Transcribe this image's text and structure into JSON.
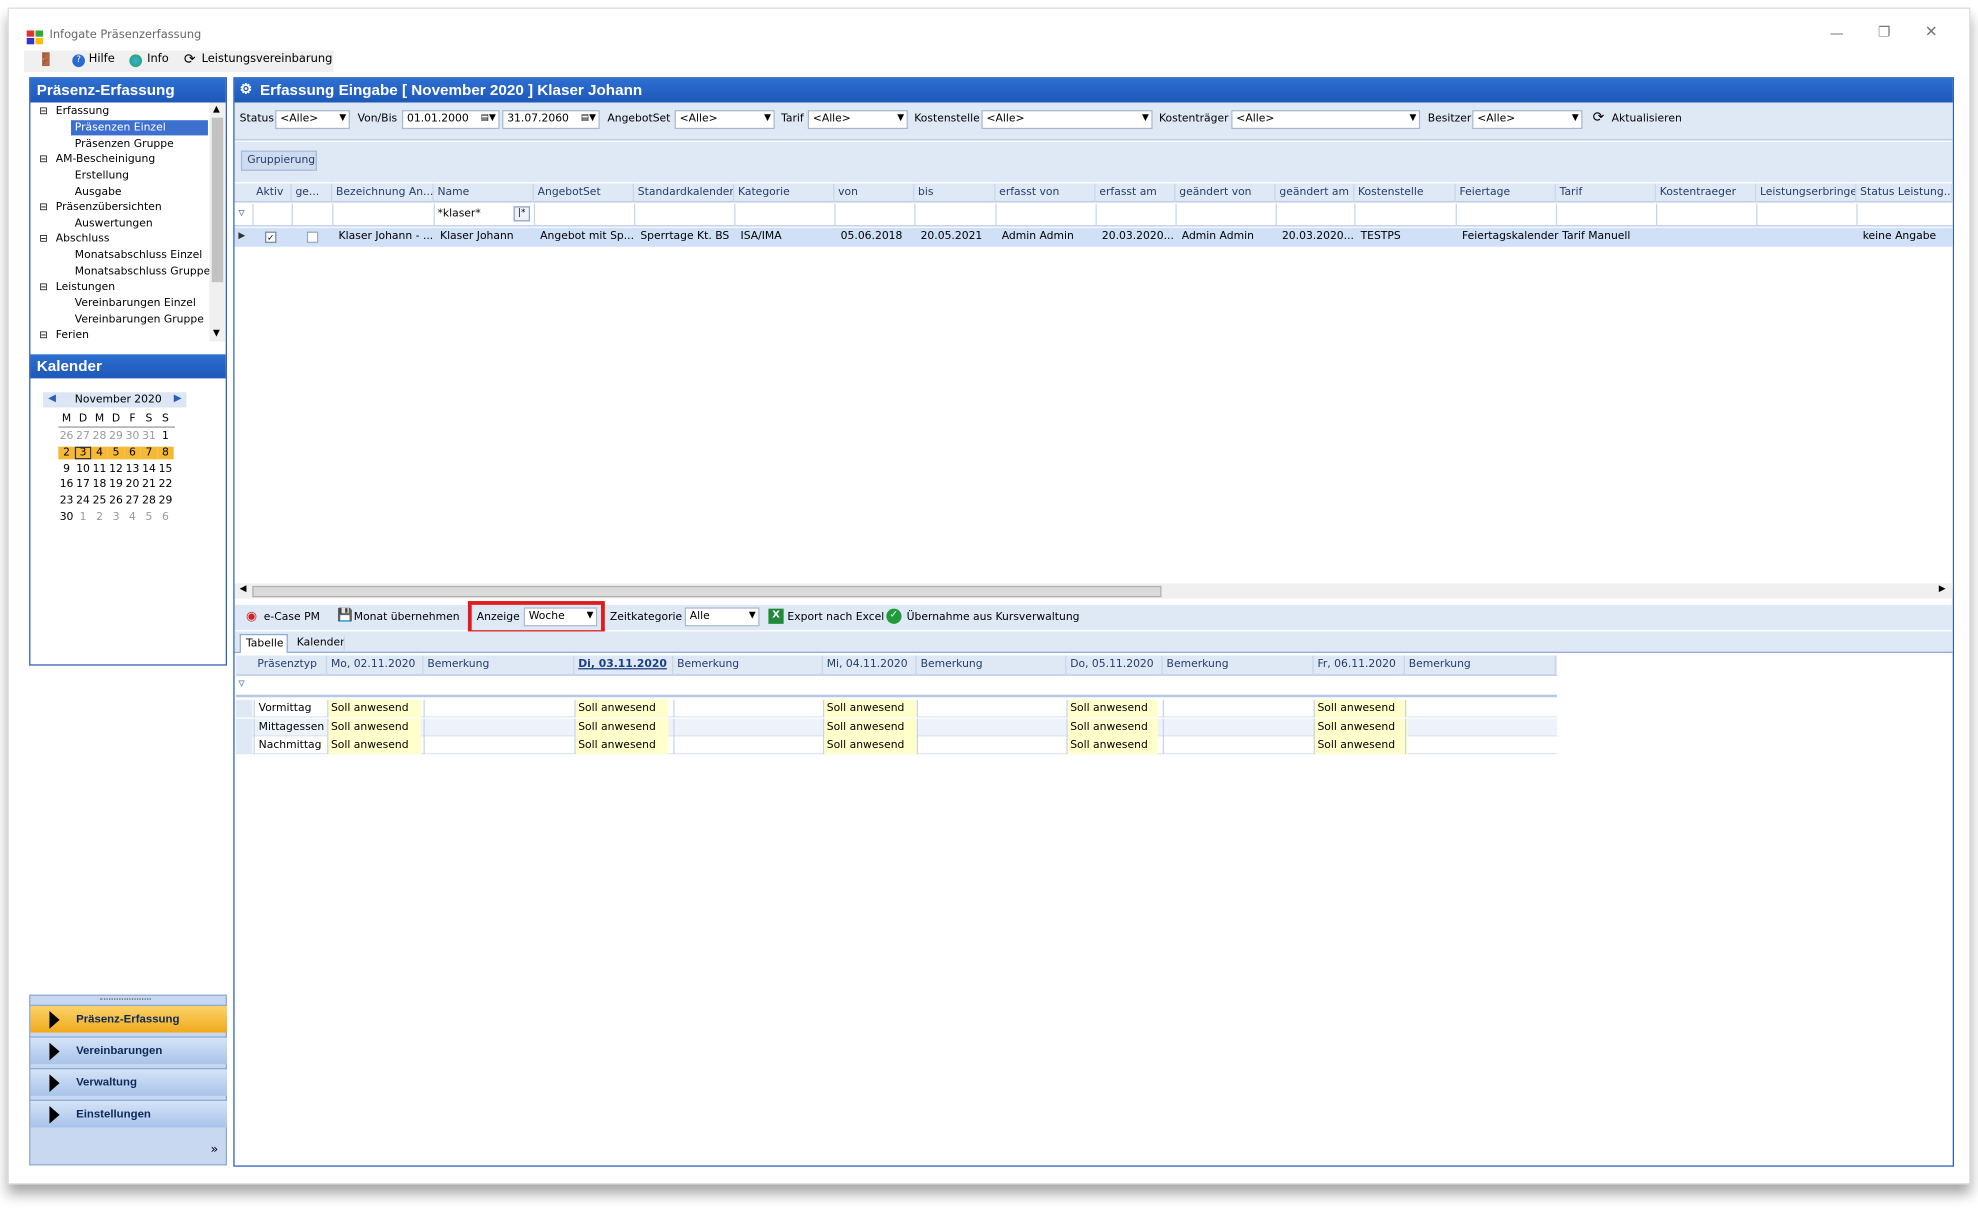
{
  "window": {
    "title": "Infogate Präsenzerfassung"
  },
  "toolbar": {
    "hilfe": "Hilfe",
    "info": "Info",
    "leistung": "Leistungsvereinbarung"
  },
  "sidebar": {
    "title": "Präsenz-Erfassung",
    "tree": [
      "Erfassung",
      "Präsenzen Einzel",
      "Präsenzen Gruppe",
      "AM-Bescheinigung",
      "Erstellung",
      "Ausgabe",
      "Präsenzübersichten",
      "Auswertungen",
      "Abschluss",
      "Monatsabschluss Einzel",
      "Monatsabschluss Gruppe",
      "Leistungen",
      "Vereinbarungen Einzel",
      "Vereinbarungen Gruppe",
      "Ferien"
    ],
    "kalender_title": "Kalender",
    "month": "November 2020",
    "weekdays": [
      "M",
      "D",
      "M",
      "D",
      "F",
      "S",
      "S"
    ],
    "weeks": [
      [
        "26",
        "27",
        "28",
        "29",
        "30",
        "31",
        "1"
      ],
      [
        "2",
        "3",
        "4",
        "5",
        "6",
        "7",
        "8"
      ],
      [
        "9",
        "10",
        "11",
        "12",
        "13",
        "14",
        "15"
      ],
      [
        "16",
        "17",
        "18",
        "19",
        "20",
        "21",
        "22"
      ],
      [
        "23",
        "24",
        "25",
        "26",
        "27",
        "28",
        "29"
      ],
      [
        "30",
        "1",
        "2",
        "3",
        "4",
        "5",
        "6"
      ]
    ],
    "nav": [
      "Präsenz-Erfassung",
      "Vereinbarungen",
      "Verwaltung",
      "Einstellungen"
    ],
    "more": "»"
  },
  "main": {
    "title": "Erfassung Eingabe  [ November 2020 ]  Klaser Johann",
    "filters": {
      "status_label": "Status",
      "status": "<Alle>",
      "vonbis_label": "Von/Bis",
      "von": "01.01.2000",
      "bis": "31.07.2060",
      "angebotset_label": "AngebotSet",
      "angebotset": "<Alle>",
      "tarif_label": "Tarif",
      "tarif": "<Alle>",
      "kostenstelle_label": "Kostenstelle",
      "kostenstelle": "<Alle>",
      "kostentraeger_label": "Kostenträger",
      "kostentraeger": "<Alle>",
      "besitzer_label": "Besitzer",
      "besitzer": "<Alle>",
      "refresh": "Aktualisieren"
    },
    "gruppierung": "Gruppierung",
    "columns": [
      "Aktiv",
      "ge...",
      "Bezeichnung An...",
      "Name",
      "AngebotSet",
      "Standardkalender",
      "Kategorie",
      "von",
      "bis",
      "erfasst von",
      "erfasst am",
      "geändert von",
      "geändert am",
      "Kostenstelle",
      "Feiertage",
      "Tarif",
      "Kostentraeger",
      "Leistungserbringer",
      "Status Leistung..."
    ],
    "filter_name": "*klaser*",
    "row": [
      "Klaser Johann - ...",
      "Klaser Johann",
      "Angebot mit Sp...",
      "Sperrtage Kt. BS",
      "ISA/IMA",
      "05.06.2018",
      "20.05.2021",
      "Admin Admin",
      "20.03.2020...",
      "Admin Admin",
      "20.03.2020...",
      "TESTPS",
      "Feiertagskalender",
      "Tarif Manuell",
      "",
      "",
      "keine Angabe"
    ]
  },
  "lower": {
    "ecase": "e-Case PM",
    "monat": "Monat übernehmen",
    "anzeige_label": "Anzeige",
    "anzeige": "Woche",
    "zeitkat_label": "Zeitkategorie",
    "zeitkat": "Alle",
    "excel": "Export nach Excel",
    "kurs": "Übernahme aus Kursverwaltung",
    "tabs": [
      "Tabelle",
      "Kalender"
    ],
    "columns": [
      "Präsenztyp",
      "Mo, 02.11.2020",
      "Bemerkung",
      "Di, 03.11.2020",
      "Bemerkung",
      "Mi, 04.11.2020",
      "Bemerkung",
      "Do, 05.11.2020",
      "Bemerkung",
      "Fr, 06.11.2020",
      "Bemerkung"
    ],
    "rows": [
      {
        "typ": "Vormittag",
        "vals": [
          "Soll anwesend",
          "Soll anwesend",
          "Soll anwesend",
          "Soll anwesend",
          "Soll anwesend"
        ]
      },
      {
        "typ": "Mittagessen",
        "vals": [
          "Soll anwesend",
          "Soll anwesend",
          "Soll anwesend",
          "Soll anwesend",
          "Soll anwesend"
        ]
      },
      {
        "typ": "Nachmittag",
        "vals": [
          "Soll anwesend",
          "Soll anwesend",
          "Soll anwesend",
          "Soll anwesend",
          "Soll anwesend"
        ]
      }
    ]
  },
  "colors": {
    "header": "#1d58b8",
    "nav_active": "#f5b935",
    "highlight": "#e21a1a",
    "soll_bg": "#ffffcc"
  }
}
